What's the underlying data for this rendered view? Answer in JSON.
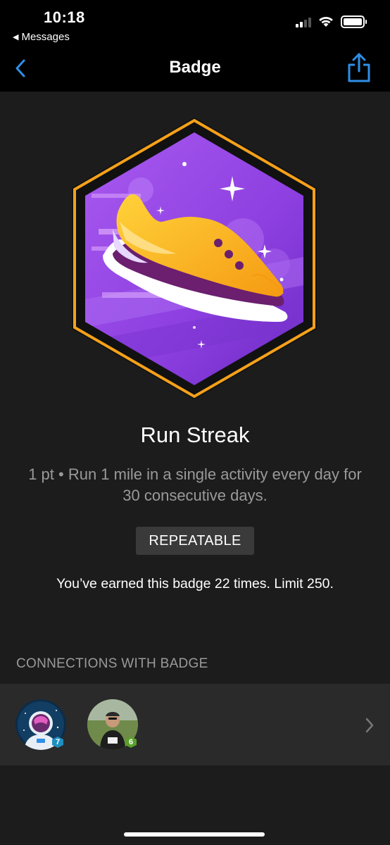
{
  "status_bar": {
    "time": "10:18",
    "back_app": "Messages"
  },
  "nav": {
    "title": "Badge",
    "back_icon": "chevron-left-icon",
    "share_icon": "share-icon",
    "accent_color": "#2f8fe6"
  },
  "badge": {
    "title": "Run Streak",
    "description": "1 pt • Run 1 mile in a single activity every day for 30 consecutive days.",
    "tag": "REPEATABLE",
    "earned_text": "You’ve earned this badge 22 times. Limit 250.",
    "frame_color": "#f5a11a",
    "background_color": "#9a4be8",
    "icon": "running-shoe-icon"
  },
  "connections": {
    "header": "CONNECTIONS WITH BADGE",
    "people": [
      {
        "avatar": "astronaut-avatar",
        "level": "7",
        "level_color": "#1f8fc0"
      },
      {
        "avatar": "runner-photo-avatar",
        "level": "6",
        "level_color": "#5aa02c"
      }
    ]
  }
}
